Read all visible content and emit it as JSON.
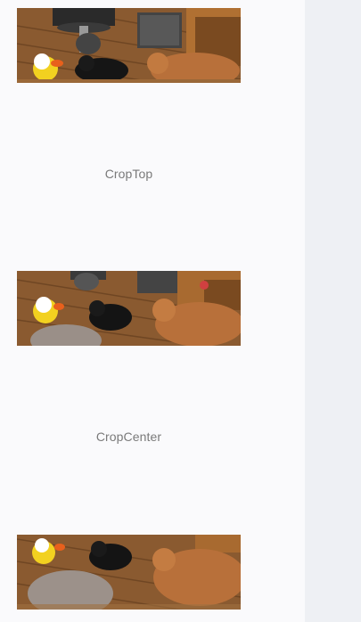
{
  "items": [
    {
      "label": ""
    },
    {
      "label": "CropTop"
    },
    {
      "label": "CropCenter"
    }
  ],
  "colors": {
    "background": "#fafafc",
    "side_panel": "#eef0f4",
    "caption_text": "#7a7a7a"
  }
}
